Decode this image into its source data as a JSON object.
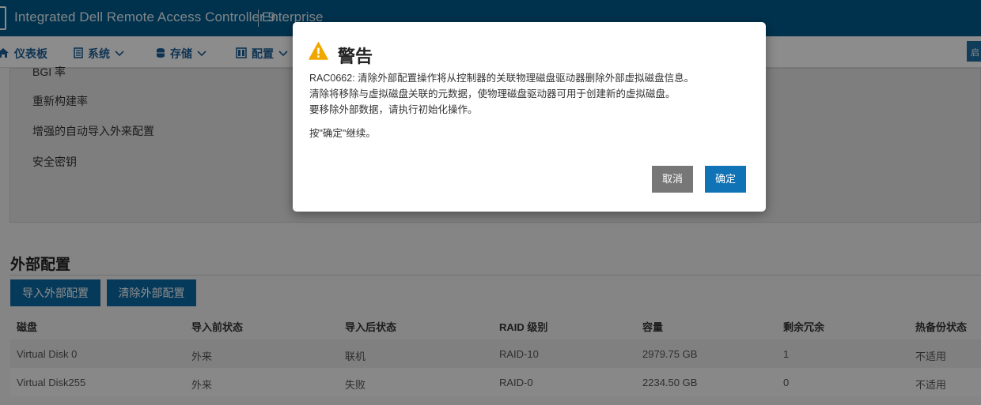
{
  "header": {
    "title": "Integrated Dell Remote Access Controller 9",
    "edition": "Enterprise"
  },
  "nav": {
    "items": [
      {
        "label": "仪表板",
        "icon": "home-icon"
      },
      {
        "label": "系统",
        "icon": "system-icon"
      },
      {
        "label": "存储",
        "icon": "storage-icon"
      },
      {
        "label": "配置",
        "icon": "config-icon"
      }
    ],
    "right_label": "启"
  },
  "controller_settings": {
    "rows": [
      "BGI 率",
      "重新构建率",
      "增强的自动导入外来配置",
      "安全密钥"
    ]
  },
  "foreign_config": {
    "title": "外部配置",
    "import_button": "导入外部配置",
    "clear_button": "清除外部配置",
    "columns": [
      "磁盘",
      "导入前状态",
      "导入后状态",
      "RAID 级别",
      "容量",
      "剩余冗余",
      "热备份状态"
    ],
    "rows": [
      [
        "Virtual Disk 0",
        "外来",
        "联机",
        "RAID-10",
        "2979.75 GB",
        "1",
        "不适用"
      ],
      [
        "Virtual Disk255",
        "外来",
        "失败",
        "RAID-0",
        "2234.50 GB",
        "0",
        "不适用"
      ]
    ]
  },
  "dialog": {
    "title": "警告",
    "icon": "warning-icon",
    "message_lines": [
      "RAC0662: 清除外部配置操作将从控制器的关联物理磁盘驱动器删除外部虚拟磁盘信息。",
      "清除将移除与虚拟磁盘关联的元数据，使物理磁盘驱动器可用于创建新的虚拟磁盘。",
      "要移除外部数据，请执行初始化操作。"
    ],
    "prompt": "按\"确定\"继续。",
    "cancel_label": "取消",
    "ok_label": "确定",
    "colors": {
      "ok": "#0f73b6",
      "cancel": "#777777",
      "warning": "#f0a800"
    }
  }
}
